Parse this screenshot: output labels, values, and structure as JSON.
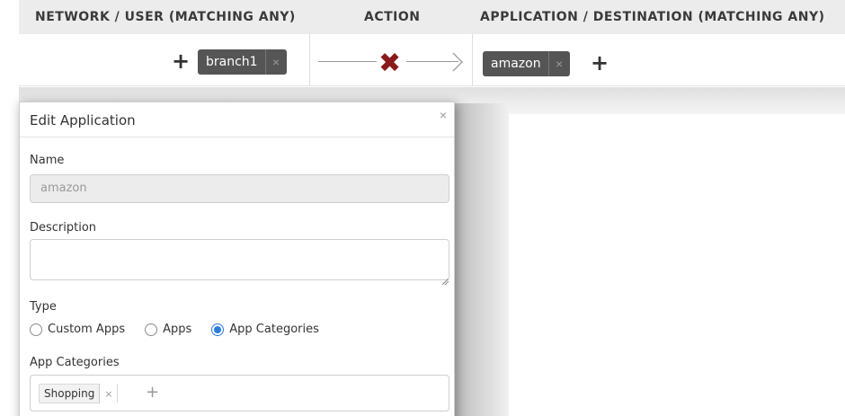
{
  "header": {
    "col_network": "NETWORK / USER (MATCHING ANY)",
    "col_action": "ACTION",
    "col_app": "APPLICATION / DESTINATION (MATCHING ANY)"
  },
  "rule": {
    "add_source_symbol": "+",
    "source_tag": "branch1",
    "tag_remove_symbol": "×",
    "action_symbol": "✖",
    "dest_tag": "amazon",
    "add_dest_symbol": "+"
  },
  "modal": {
    "title": "Edit Application",
    "close_symbol": "×",
    "name_label": "Name",
    "name_value": "amazon",
    "description_label": "Description",
    "description_value": "",
    "type_label": "Type",
    "type_options": [
      "Custom Apps",
      "Apps",
      "App Categories"
    ],
    "type_selected": "App Categories",
    "categories_label": "App Categories",
    "categories": [
      "Shopping"
    ],
    "category_remove_symbol": "×",
    "add_category_symbol": "+"
  },
  "colors": {
    "deny": "#8b1a1a",
    "tag_bg": "#555555",
    "radio_selected": "#2a7de1"
  }
}
